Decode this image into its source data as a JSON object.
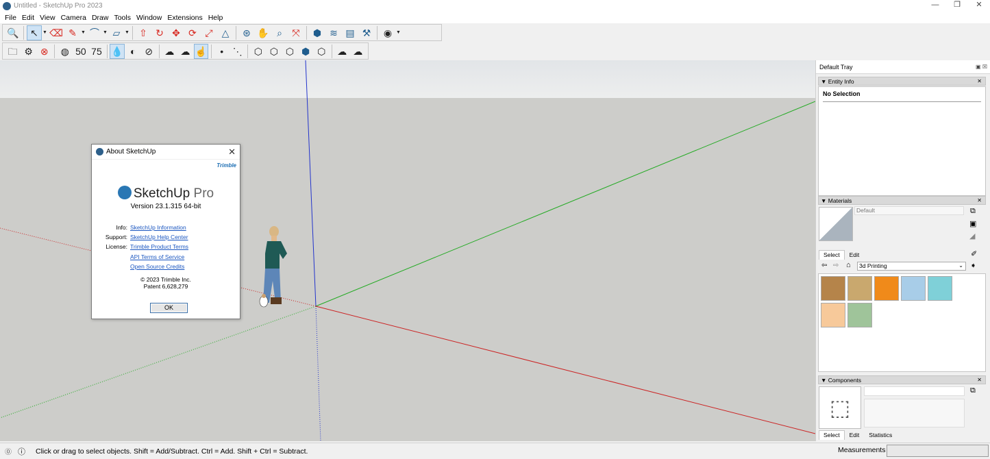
{
  "window": {
    "title": "Untitled - SketchUp Pro 2023",
    "controls": [
      "—",
      "❐",
      "✕"
    ]
  },
  "menu": [
    "File",
    "Edit",
    "View",
    "Camera",
    "Draw",
    "Tools",
    "Window",
    "Extensions",
    "Help"
  ],
  "toolbar1": [
    {
      "icon": "zoom-icon",
      "glyph": "🔍",
      "style": "blue"
    },
    {
      "icon": "select-icon",
      "glyph": "↖",
      "style": "dark",
      "active": true
    },
    {
      "icon": "eraser-icon",
      "glyph": "⌫",
      "style": "red"
    },
    {
      "icon": "pencil-icon",
      "glyph": "✎",
      "style": "red"
    },
    {
      "icon": "arc-icon",
      "glyph": "⌒",
      "style": "blue"
    },
    {
      "icon": "rectangle-icon",
      "glyph": "▱",
      "style": "blue"
    },
    {
      "icon": "push-pull-icon",
      "glyph": "⇧",
      "style": "red"
    },
    {
      "icon": "follow-me-icon",
      "glyph": "↻",
      "style": "red"
    },
    {
      "icon": "move-icon",
      "glyph": "✥",
      "style": "red"
    },
    {
      "icon": "rotate-icon",
      "glyph": "⟳",
      "style": "red"
    },
    {
      "icon": "scale-icon",
      "glyph": "⤢",
      "style": "red"
    },
    {
      "icon": "tape-measure-icon",
      "glyph": "△",
      "style": "blue"
    },
    {
      "icon": "orbit-icon",
      "glyph": "⊛",
      "style": "blue"
    },
    {
      "icon": "pan-icon",
      "glyph": "✋",
      "style": "red"
    },
    {
      "icon": "zoom-window-icon",
      "glyph": "⌕",
      "style": "blue"
    },
    {
      "icon": "zoom-extents-icon",
      "glyph": "⤧",
      "style": "red"
    },
    {
      "icon": "warehouse-icon",
      "glyph": "⬢",
      "style": "blue"
    },
    {
      "icon": "extension-warehouse-icon",
      "glyph": "≋",
      "style": "blue"
    },
    {
      "icon": "layout-icon",
      "glyph": "▤",
      "style": "blue"
    },
    {
      "icon": "extension-manager-icon",
      "glyph": "⚒",
      "style": "blue"
    },
    {
      "icon": "account-icon",
      "glyph": "◉",
      "style": "dark"
    }
  ],
  "toolbar2": [
    {
      "icon": "open-folder-icon",
      "glyph": "🗀",
      "style": "dark"
    },
    {
      "icon": "settings-gear-icon",
      "glyph": "⚙",
      "style": "dark"
    },
    {
      "icon": "cancel-circle-icon",
      "glyph": "⊗",
      "style": "red"
    },
    {
      "icon": "eye-icon",
      "glyph": "◍",
      "style": "dark"
    },
    {
      "icon": "opacity-50-icon",
      "glyph": "50",
      "style": "dark"
    },
    {
      "icon": "opacity-75-icon",
      "glyph": "75",
      "style": "dark"
    },
    {
      "icon": "drop-icon",
      "glyph": "💧",
      "style": "blue",
      "active": true
    },
    {
      "icon": "half-circle-icon",
      "glyph": "◐",
      "style": "dark"
    },
    {
      "icon": "hatched-circle-icon",
      "glyph": "⊘",
      "style": "dark"
    },
    {
      "icon": "cloud-x-icon",
      "glyph": "☁",
      "style": "dark"
    },
    {
      "icon": "cloud-upload-icon",
      "glyph": "☁",
      "style": "dark"
    },
    {
      "icon": "hand-select-icon",
      "glyph": "☝",
      "style": "blue",
      "active": true
    },
    {
      "icon": "point-icon",
      "glyph": "•",
      "style": "dark"
    },
    {
      "icon": "dotted-line-icon",
      "glyph": "⋱",
      "style": "dark"
    },
    {
      "icon": "hex-settings-icon",
      "glyph": "⬡",
      "style": "dark"
    },
    {
      "icon": "hex-outline-icon",
      "glyph": "⬡",
      "style": "dark"
    },
    {
      "icon": "cloud-hex-icon",
      "glyph": "⬡",
      "style": "dark"
    },
    {
      "icon": "hex-solid-icon",
      "glyph": "⬢",
      "style": "blue"
    },
    {
      "icon": "hex-dotted-icon",
      "glyph": "⬡",
      "style": "dark"
    },
    {
      "icon": "cloud-sync-icon",
      "glyph": "☁",
      "style": "dark"
    },
    {
      "icon": "cloud-refresh-icon",
      "glyph": "☁",
      "style": "dark"
    }
  ],
  "about": {
    "title": "About SketchUp",
    "brand": "Trimble",
    "product_main": "SketchUp",
    "product_sub": "Pro",
    "version": "Version 23.1.315 64-bit",
    "rows": [
      {
        "key": "Info:",
        "value": "SketchUp Information"
      },
      {
        "key": "Support:",
        "value": "SketchUp Help Center"
      },
      {
        "key": "License:",
        "value": "Trimble Product Terms"
      },
      {
        "key": "",
        "value": "API Terms of Service"
      },
      {
        "key": "",
        "value": "Open Source Credits"
      }
    ],
    "copyright": "© 2023 Trimble Inc.",
    "patent": "Patent 6,628,279",
    "ok": "OK"
  },
  "tray": {
    "title": "Default Tray",
    "entity_info": {
      "title": "Entity Info",
      "selection": "No Selection"
    },
    "materials": {
      "title": "Materials",
      "material_name": "Default",
      "tabs": [
        "Select",
        "Edit"
      ],
      "library": "3d Printing",
      "swatch_colors": [
        "#b5844a",
        "#c9a86e",
        "#f08a1a",
        "#a8cde8",
        "#7fd0d8",
        "#f7c99a",
        "#9fc49a"
      ]
    },
    "components": {
      "title": "Components",
      "tabs": [
        "Select",
        "Edit",
        "Statistics"
      ]
    }
  },
  "status": {
    "message": "Click or drag to select objects. Shift = Add/Subtract. Ctrl = Add. Shift + Ctrl = Subtract.",
    "measurements_label": "Measurements",
    "measurements_value": ""
  }
}
